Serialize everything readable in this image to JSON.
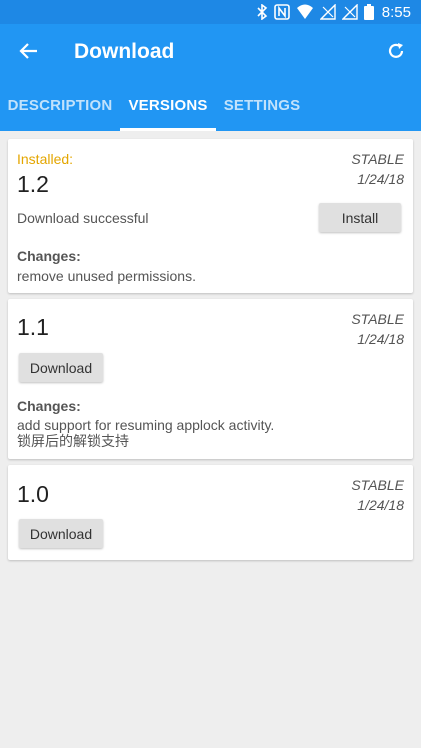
{
  "status_bar": {
    "time": "8:55",
    "icons": [
      "bluetooth-icon",
      "nfc-icon",
      "wifi-icon",
      "signal-icon",
      "signal-icon",
      "battery-icon"
    ]
  },
  "appbar": {
    "title": "Download",
    "back_icon": "arrow-back-icon",
    "refresh_icon": "refresh-icon"
  },
  "tabs": [
    {
      "label": "DESCRIPTION",
      "active": false
    },
    {
      "label": "VERSIONS",
      "active": true
    },
    {
      "label": "SETTINGS",
      "active": false
    }
  ],
  "versions": [
    {
      "installed_label": "Installed:",
      "version": "1.2",
      "channel": "STABLE",
      "date": "1/24/18",
      "status": "Download successful",
      "action_label": "Install",
      "changes_label": "Changes:",
      "changes": [
        "remove unused permissions."
      ]
    },
    {
      "version": "1.1",
      "channel": "STABLE",
      "date": "1/24/18",
      "action_label": "Download",
      "changes_label": "Changes:",
      "changes": [
        "add support for resuming applock activity.",
        "锁屏后的解锁支持"
      ]
    },
    {
      "version": "1.0",
      "channel": "STABLE",
      "date": "1/24/18",
      "action_label": "Download"
    }
  ],
  "colors": {
    "primary": "#2196f3",
    "primary_dark": "#1e88e5",
    "installed": "#e4a600",
    "background": "#eeeeee"
  }
}
